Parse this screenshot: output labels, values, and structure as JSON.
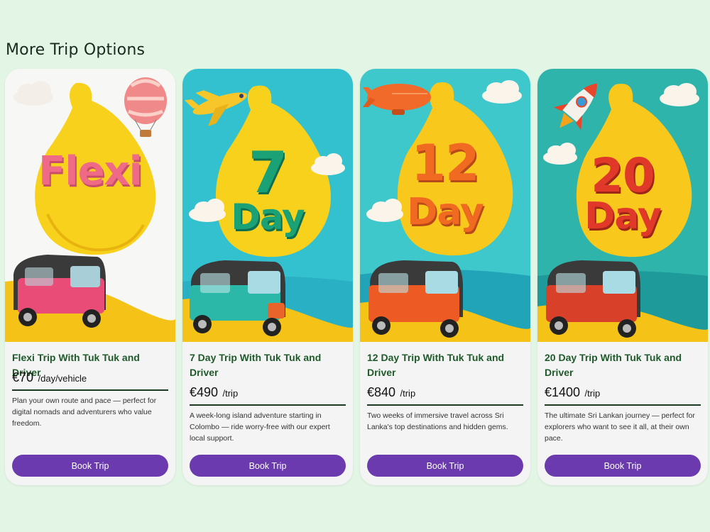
{
  "section_title": "More Trip Options",
  "cards": [
    {
      "hero_word_top": "",
      "hero_word_bottom": "Flexi",
      "title": "Flexi Trip With Tuk Tuk and Driver",
      "price": "€70",
      "unit": "/day/vehicle",
      "description": "Plan your own route and pace — perfect for digital nomads and adventurers who value freedom.",
      "button": "Book Trip"
    },
    {
      "hero_word_top": "7",
      "hero_word_bottom": "Day",
      "title": "7 Day Trip With Tuk Tuk and Driver",
      "price": "€490",
      "unit": "/trip",
      "description": "A week-long island adventure starting in Colombo — ride worry-free with our expert local support.",
      "button": "Book Trip"
    },
    {
      "hero_word_top": "12",
      "hero_word_bottom": "Day",
      "title": "12 Day Trip With Tuk Tuk and Driver",
      "price": "€840",
      "unit": "/trip",
      "description": "Two weeks of immersive travel across Sri Lanka's top destinations and hidden gems.",
      "button": "Book Trip"
    },
    {
      "hero_word_top": "20",
      "hero_word_bottom": "Day",
      "title": "20 Day Trip With Tuk Tuk and Driver",
      "price": "€1400",
      "unit": "/trip",
      "description": "The ultimate Sri Lankan journey — perfect for explorers who want to see it all, at their own pace.",
      "button": "Book Trip"
    }
  ],
  "colors": {
    "background": "#e3f6e6",
    "button": "#6a3aae",
    "title_green": "#1e5a2a"
  }
}
